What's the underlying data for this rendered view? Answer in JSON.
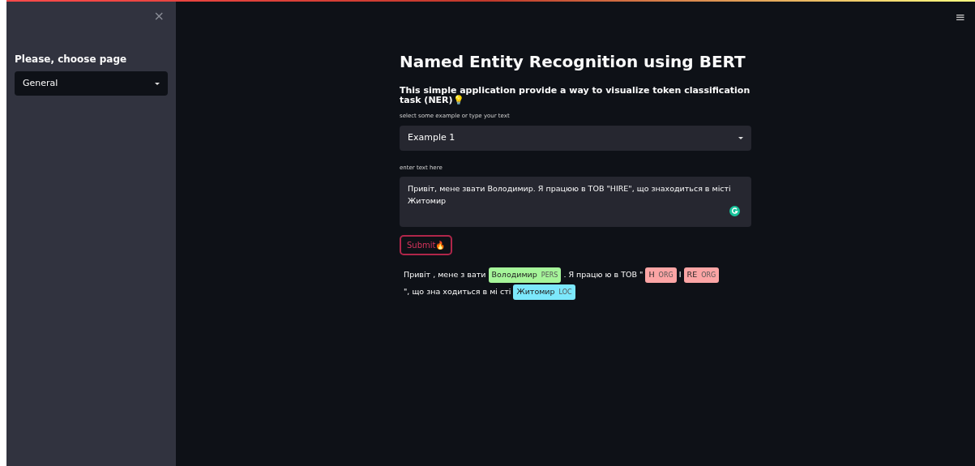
{
  "sidebar": {
    "close": "×",
    "label": "Please, choose page",
    "select": {
      "value": "General"
    }
  },
  "menu": "≡",
  "title": "Named Entity Recognition using BERT",
  "subtitle": "This simple application provide a way to visualize token classification task (NER)💡",
  "example": {
    "label": "select some example or type your text",
    "value": "Example 1"
  },
  "input": {
    "label": "enter text here",
    "value": "Привіт, мене звати Володимир. Я працюю в ТОВ \"HIRE\", що знаходиться в місті Житомир"
  },
  "submit": "Submit🔥",
  "result": [
    {
      "kind": "text",
      "text": "Привіт , мене з вати"
    },
    {
      "kind": "entity",
      "text": "Володимир",
      "label": "PERS",
      "color": "#a6f59a"
    },
    {
      "kind": "text",
      "text": ". Я працю ю в ТОВ \""
    },
    {
      "kind": "entity",
      "text": "H",
      "label": "ORG",
      "color": "#fca5a5"
    },
    {
      "kind": "text",
      "text": "I"
    },
    {
      "kind": "entity",
      "text": "RE",
      "label": "ORG",
      "color": "#fca5a5"
    },
    {
      "kind": "text",
      "text": "\", що зна"
    },
    {
      "kind": "text",
      "text": "ходиться в мі сті"
    },
    {
      "kind": "entity",
      "text": "Житомир",
      "label": "LOC",
      "color": "#7ce8fc"
    }
  ]
}
